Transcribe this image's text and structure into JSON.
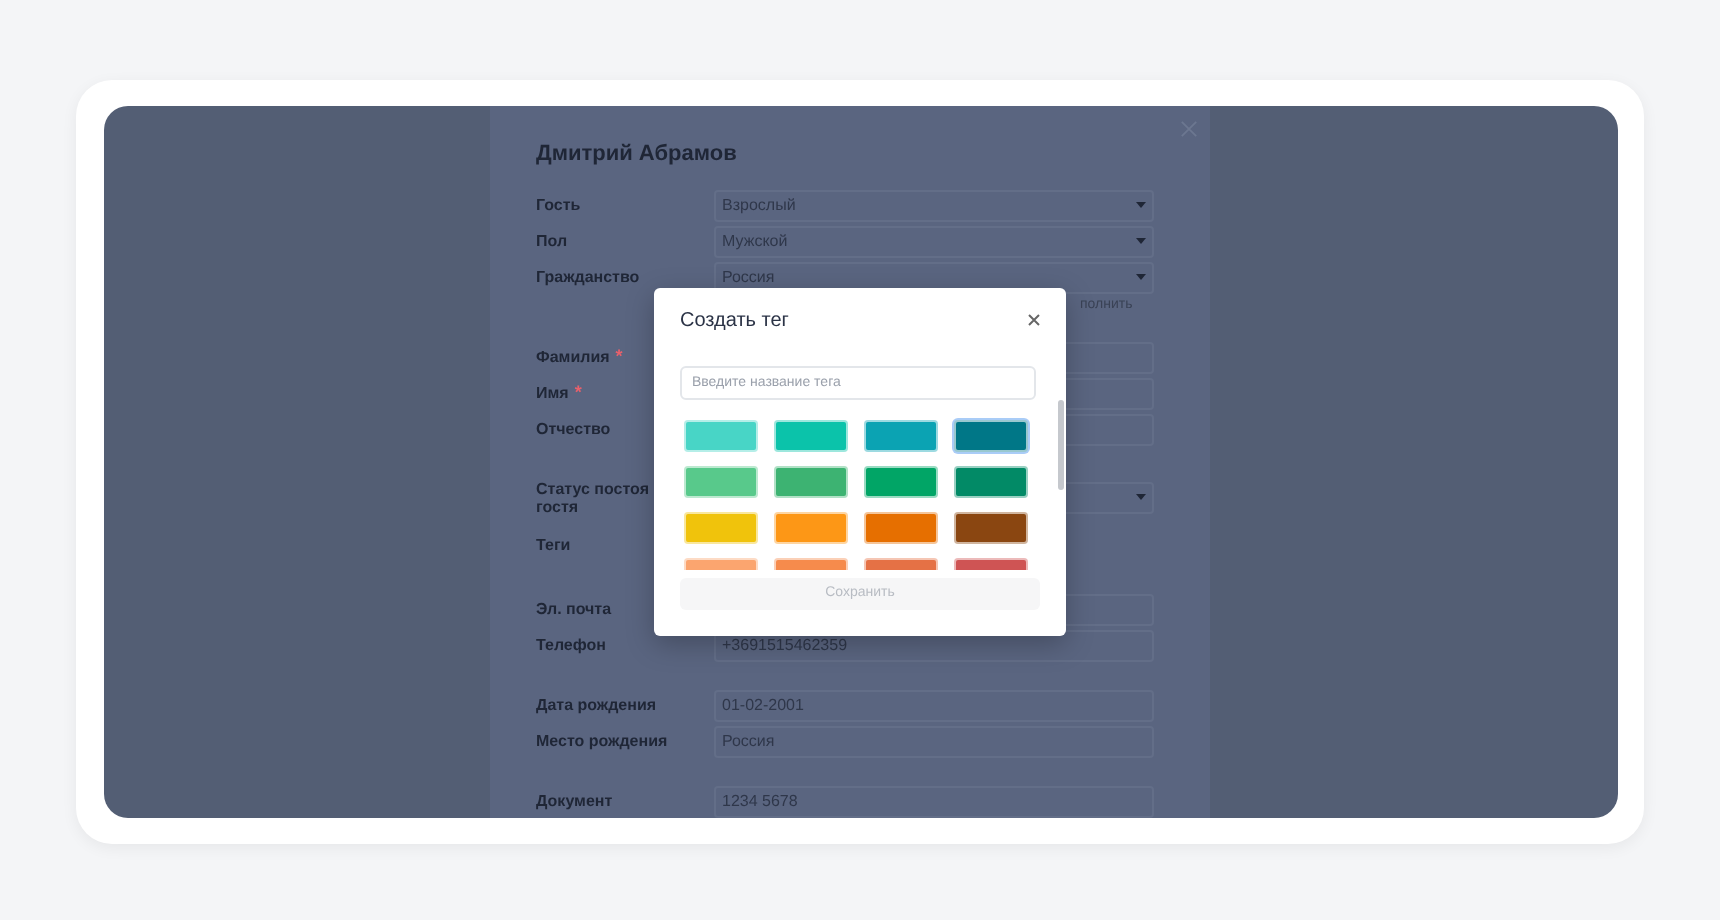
{
  "drawer": {
    "title": "Дмитрий Абрамов",
    "groups": [
      {
        "fields": [
          {
            "label": "Гость",
            "kind": "select",
            "value": "Взрослый"
          },
          {
            "label": "Пол",
            "kind": "select",
            "value": "Мужской"
          },
          {
            "label": "Гражданство",
            "kind": "select",
            "value": "Россия"
          }
        ],
        "hint": "полнить"
      },
      {
        "fields": [
          {
            "label": "Фамилия",
            "mark": "*",
            "kind": "input"
          },
          {
            "label": "Имя",
            "mark": "*",
            "kind": "input"
          },
          {
            "label": "Отчество",
            "kind": "input"
          }
        ]
      },
      {
        "fields": [
          {
            "label_lines": [
              "Статус постоя",
              "гостя"
            ],
            "kind": "select"
          },
          {
            "label": "Теги",
            "kind": "tags"
          }
        ]
      },
      {
        "fields": [
          {
            "label": "Эл. почта",
            "kind": "input"
          },
          {
            "label": "Телефон",
            "kind": "input",
            "value": "+3691515462359"
          }
        ]
      },
      {
        "fields": [
          {
            "label": "Дата рождения",
            "kind": "input",
            "value": "01-02-2001"
          },
          {
            "label": "Место рождения",
            "kind": "input",
            "value": "Россия"
          }
        ]
      },
      {
        "fields": [
          {
            "label": "Документ",
            "kind": "input",
            "value": "1234 5678"
          }
        ]
      }
    ]
  },
  "modal": {
    "title": "Создать тег",
    "placeholder": "Введите название тега",
    "save": "Сохранить",
    "save_disabled": true,
    "swatches": [
      {
        "color": "#48d5c6",
        "selected": false
      },
      {
        "color": "#0bc3aa",
        "selected": false
      },
      {
        "color": "#0ba3b3",
        "selected": false
      },
      {
        "color": "#007787",
        "selected": true
      },
      {
        "color": "#58c98b",
        "selected": false
      },
      {
        "color": "#3db372",
        "selected": false
      },
      {
        "color": "#01a566",
        "selected": false
      },
      {
        "color": "#028a66",
        "selected": false
      },
      {
        "color": "#f0c30c",
        "selected": false
      },
      {
        "color": "#fd9716",
        "selected": false
      },
      {
        "color": "#e66f00",
        "selected": false
      },
      {
        "color": "#8a4611",
        "selected": false
      },
      {
        "color": "#fba56f",
        "selected": false
      },
      {
        "color": "#f68b4c",
        "selected": false
      },
      {
        "color": "#e57145",
        "selected": false
      },
      {
        "color": "#cf5454",
        "selected": false
      }
    ]
  }
}
